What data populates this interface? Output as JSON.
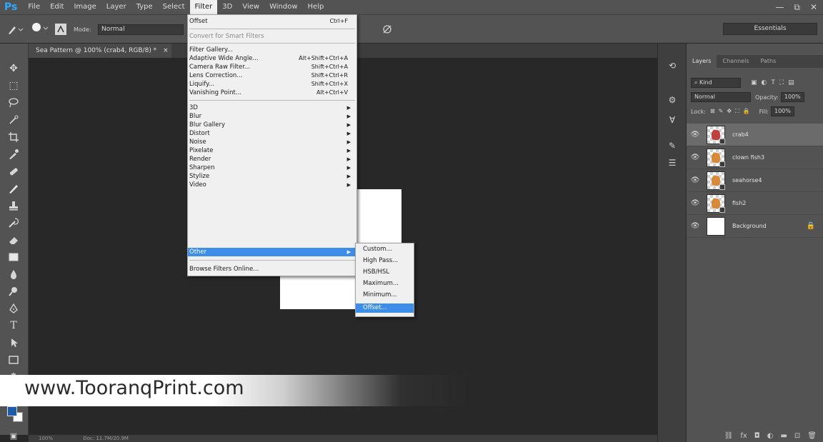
{
  "app": {
    "logo": "Ps",
    "menus": [
      "File",
      "Edit",
      "Image",
      "Layer",
      "Type",
      "Select",
      "Filter",
      "3D",
      "View",
      "Window",
      "Help"
    ],
    "active_menu": "Filter",
    "window_controls": [
      "—",
      "⧉",
      "✕"
    ]
  },
  "options_bar": {
    "mode_label": "Mode:",
    "mode_value": "Normal",
    "workspace": "Essentials"
  },
  "document": {
    "tab_title": "Sea Pattern @ 100% (crab4, RGB/8) *",
    "status_zoom": "100%",
    "status_doc": "Doc: 11.7M/20.9M"
  },
  "filter_menu": {
    "items": [
      {
        "label": "Offset",
        "shortcut": "Ctrl+F"
      },
      {
        "label": "Convert for Smart Filters",
        "disabled": true
      },
      {
        "label": "Filter Gallery..."
      },
      {
        "label": "Adaptive Wide Angle...",
        "shortcut": "Alt+Shift+Ctrl+A"
      },
      {
        "label": "Camera Raw Filter...",
        "shortcut": "Shift+Ctrl+A"
      },
      {
        "label": "Lens Correction...",
        "shortcut": "Shift+Ctrl+R"
      },
      {
        "label": "Liquify...",
        "shortcut": "Shift+Ctrl+X"
      },
      {
        "label": "Vanishing Point...",
        "shortcut": "Alt+Ctrl+V"
      },
      {
        "label": "3D"
      },
      {
        "label": "Blur"
      },
      {
        "label": "Blur Gallery"
      },
      {
        "label": "Distort"
      },
      {
        "label": "Noise"
      },
      {
        "label": "Pixelate"
      },
      {
        "label": "Render"
      },
      {
        "label": "Sharpen"
      },
      {
        "label": "Stylize"
      },
      {
        "label": "Video"
      },
      {
        "label": "Other"
      },
      {
        "label": "Browse Filters Online..."
      }
    ]
  },
  "other_submenu": {
    "items": [
      "Custom...",
      "High Pass...",
      "HSB/HSL",
      "Maximum...",
      "Minimum...",
      "Offset..."
    ],
    "highlighted": "Offset..."
  },
  "layers_panel": {
    "tabs": [
      "Layers",
      "Channels",
      "Paths"
    ],
    "kind": "Kind",
    "blend_mode": "Normal",
    "opacity_label": "Opacity:",
    "opacity": "100%",
    "lock_label": "Lock:",
    "fill_label": "Fill:",
    "fill": "100%",
    "layers": [
      {
        "name": "crab4",
        "selected": true
      },
      {
        "name": "clown fish3"
      },
      {
        "name": "seahorse4"
      },
      {
        "name": "fish2"
      },
      {
        "name": "Background"
      }
    ]
  },
  "watermark": {
    "text": "www.TooranqPrint.com"
  },
  "colors": {
    "menu_highlight": "#3d8ee8",
    "foreground": "#1e5ba8",
    "background": "#ffffff"
  }
}
